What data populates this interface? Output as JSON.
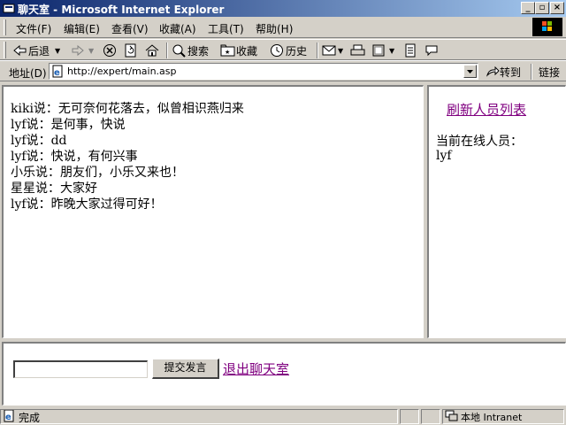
{
  "window": {
    "title": "聊天室 - Microsoft Internet Explorer"
  },
  "menu": [
    "文件(F)",
    "编辑(E)",
    "查看(V)",
    "收藏(A)",
    "工具(T)",
    "帮助(H)"
  ],
  "toolbar": {
    "back": "后退",
    "search": "搜索",
    "favorites": "收藏",
    "history": "历史"
  },
  "address": {
    "label": "地址(D)",
    "url": "http://expert/main.asp",
    "go": "转到",
    "links": "链接"
  },
  "chat": {
    "messages": [
      "kiki说：无可奈何花落去，似曾相识燕归来",
      "lyf说：是何事，快说",
      "lyf说：dd",
      "lyf说：快说，有何兴事",
      "小乐说：朋友们，小乐又来也！",
      "星星说：大家好",
      "lyf说：昨晚大家过得可好！"
    ]
  },
  "users": {
    "refresh_link": "刷新人员列表",
    "online_label": "当前在线人员：",
    "list": [
      "lyf"
    ]
  },
  "compose": {
    "input_value": "",
    "submit_label": "提交发言",
    "exit_link": "退出聊天室"
  },
  "status": {
    "text": "完成",
    "zone": "本地 Intranet"
  }
}
